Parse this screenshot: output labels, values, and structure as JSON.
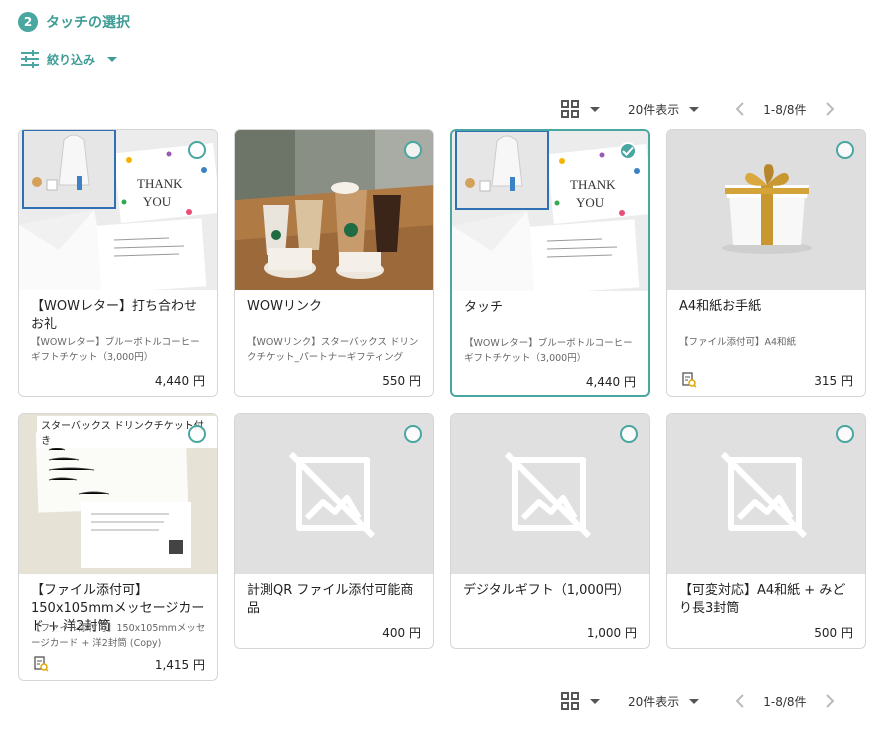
{
  "step": {
    "number": "2",
    "title": "タッチの選択"
  },
  "filter": {
    "label": "絞り込み"
  },
  "toolbar": {
    "per_page": "20件表示",
    "range": "1-8/8件"
  },
  "colors": {
    "accent": "#4aa6a0",
    "placeholder_bg": "#e0e0e0"
  },
  "cards": [
    {
      "title": "【WOWレター】打ち合わせお礼",
      "desc": "【WOWレター】ブルーボトルコーヒーギフトチケット（3,000円）",
      "price": "4,440 円",
      "image": "thank-you-letter-photo",
      "selected": false,
      "has_file_icon": false
    },
    {
      "title": "WOWリンク",
      "desc": "【WOWリンク】スターバックス ドリンクチケット_パートナーギフティング",
      "price": "550 円",
      "image": "starbucks-drinks-photo",
      "selected": false,
      "has_file_icon": false
    },
    {
      "title": "タッチ",
      "desc": "【WOWレター】ブルーボトルコーヒーギフトチケット（3,000円）",
      "price": "4,440 円",
      "image": "thank-you-letter-photo",
      "selected": true,
      "has_file_icon": false
    },
    {
      "title": "A4和紙お手紙",
      "desc": "【ファイル添付可】A4和紙",
      "price": "315 円",
      "image": "gift-box-photo",
      "selected": false,
      "has_file_icon": true
    },
    {
      "title": "【ファイル添付可】150x105mmメッセージカード + 洋2封筒",
      "desc": "【ファイル添付可】150x105mmメッセージカード + 洋2封筒 (Copy)",
      "price": "1,415 円",
      "image": "message-card-photo",
      "image_caption": "スターバックス ドリンクチケット付き",
      "selected": false,
      "has_file_icon": true
    },
    {
      "title": "計測QR ファイル添付可能商品",
      "desc": "",
      "price": "400 円",
      "image": "no-image-placeholder",
      "selected": false,
      "has_file_icon": false
    },
    {
      "title": "デジタルギフト（1,000円）",
      "desc": "",
      "price": "1,000 円",
      "image": "no-image-placeholder",
      "selected": false,
      "has_file_icon": false
    },
    {
      "title": "【可変対応】A4和紙 + みどり長3封筒",
      "desc": "",
      "price": "500 円",
      "image": "no-image-placeholder",
      "selected": false,
      "has_file_icon": false
    }
  ]
}
